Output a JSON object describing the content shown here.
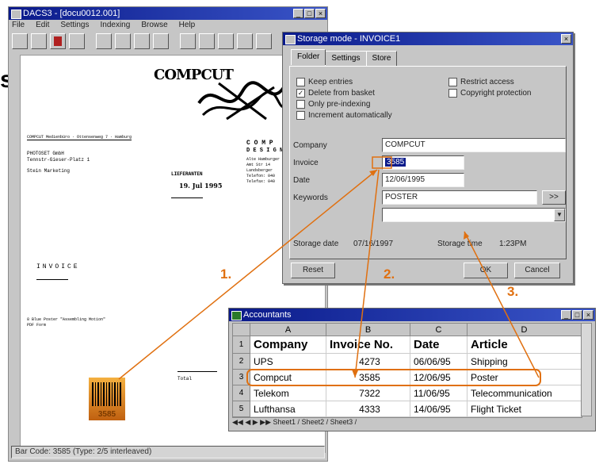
{
  "main_window": {
    "title": "DACS3 - [docu0012.001]",
    "menu": [
      "File",
      "Edit",
      "Settings",
      "Indexing",
      "Browse",
      "Help"
    ],
    "status": "Bar Code: 3585 (Type: 2/5 interleaved)"
  },
  "document": {
    "logo_text": "COMPCUT",
    "sender_line": "COMPCUT Medienbüro · Ottensenweg 7 · Hamburg",
    "recipient_lines": [
      "PHOTOSET GmbH",
      "Tennstr-Gieser-Platz 1",
      "Stein Marketing"
    ],
    "company_block": [
      "C O M P",
      "D E S I G N",
      "Alte Hamburger",
      "Amt Str 14",
      "Landsberger",
      "Telefon: 040",
      "Telefax: 040"
    ],
    "stamp_label": "LIEFERANTEN",
    "stamp_date": "19. Jul 1995",
    "heading": "INVOICE",
    "body_line1": "8 Blue Poster \"Assembling Motion\"",
    "body_line2": "PDF Form",
    "amount_label": "Total",
    "barcode_value": "3585",
    "cut_letter": "s"
  },
  "dialog": {
    "title": "Storage mode - INVOICE1",
    "tabs": [
      "Folder",
      "Settings",
      "Store"
    ],
    "checkboxes_left": [
      {
        "label": "Keep entries",
        "checked": false
      },
      {
        "label": "Delete from basket",
        "checked": true
      },
      {
        "label": "Only pre-indexing",
        "checked": false
      },
      {
        "label": "Increment automatically",
        "checked": false
      }
    ],
    "checkboxes_right": [
      {
        "label": "Restrict access",
        "checked": false
      },
      {
        "label": "Copyright protection",
        "checked": false
      }
    ],
    "fields": {
      "company_label": "Company",
      "company_value": "COMPCUT",
      "invoice_label": "Invoice",
      "invoice_value": "3585",
      "date_label": "Date",
      "date_value": "12/06/1995",
      "keywords_label": "Keywords",
      "keywords_value": "POSTER",
      "keywords_button": ">>"
    },
    "storage_date_label": "Storage date",
    "storage_date_value": "07/16/1997",
    "storage_time_label": "Storage time",
    "storage_time_value": "1:23PM",
    "buttons": {
      "reset": "Reset",
      "ok": "OK",
      "cancel": "Cancel"
    }
  },
  "spreadsheet": {
    "title": "Accountants",
    "columns": [
      "A",
      "B",
      "C",
      "D"
    ],
    "header_row": [
      "Company",
      "Invoice No.",
      "Date",
      "Article"
    ],
    "rows": [
      [
        "UPS",
        "4273",
        "06/06/95",
        "Shipping"
      ],
      [
        "Compcut",
        "3585",
        "12/06/95",
        "Poster"
      ],
      [
        "Telekom",
        "7322",
        "11/06/95",
        "Telecommunication"
      ],
      [
        "Lufthansa",
        "4333",
        "14/06/95",
        "Flight Ticket"
      ]
    ],
    "row_numbers": [
      "1",
      "2",
      "3",
      "4",
      "5"
    ],
    "sheet_tabs": "Sheet1 / Sheet2 / Sheet3 /"
  },
  "steps": [
    "1.",
    "2.",
    "3."
  ],
  "colors": {
    "accent": "#e07010",
    "titlebar": "#0a1a8a"
  }
}
